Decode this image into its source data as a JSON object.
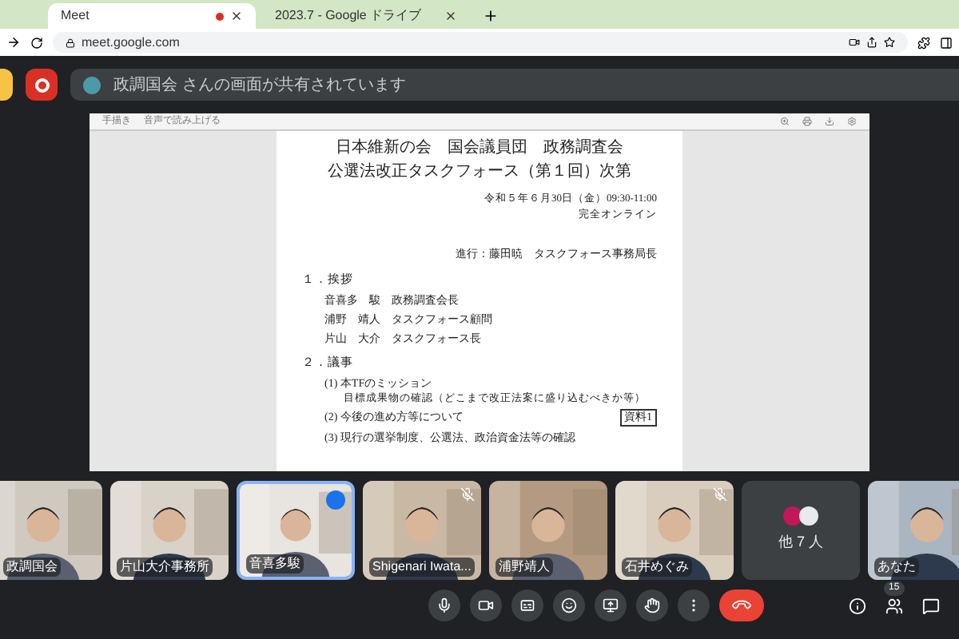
{
  "browser": {
    "tabs": [
      {
        "title": "Meet",
        "recording": true,
        "selected": true
      },
      {
        "title": "2023.7 - Google ドライブ",
        "recording": false,
        "selected": false
      }
    ],
    "url": "meet.google.com"
  },
  "banner": {
    "text": "政調国会 さんの画面が共有されています"
  },
  "viewer_toolbar": {
    "pen_label": "手描き",
    "read_aloud": "音声で読み上げる"
  },
  "document": {
    "title_lines": [
      "日本維新の会　国会議員団　政務調査会",
      "公選法改正タスクフォース（第１回）次第"
    ],
    "meta_lines": [
      "令和５年６月30日（金）09:30-11:00",
      "完全オンライン"
    ],
    "moderator": "進行：藤田暁　タスクフォース事務局長",
    "sections": [
      {
        "heading": "１．挨拶",
        "items": [
          {
            "text": "音喜多　駿　政務調査会長"
          },
          {
            "text": "浦野　靖人　タスクフォース顧問"
          },
          {
            "text": "片山　大介　タスクフォース長"
          }
        ]
      },
      {
        "heading": "２．議事",
        "items": [
          {
            "text": "(1) 本TFのミッション",
            "sub": "目標成果物の確認（どこまで改正法案に盛り込むべきか等）"
          },
          {
            "text": "(2) 今後の進め方等について",
            "tag": "資料1"
          },
          {
            "text": "(3) 現行の選挙制度、公選法、政治資金法等の確認"
          }
        ]
      }
    ]
  },
  "participants": [
    {
      "kind": "video",
      "name": "政調国会",
      "selected": false,
      "muted": false
    },
    {
      "kind": "video",
      "name": "片山大介事務所",
      "selected": false,
      "muted": false
    },
    {
      "kind": "video",
      "name": "音喜多駿",
      "selected": true,
      "muted": false
    },
    {
      "kind": "video",
      "name": "Shigenari Iwata...",
      "selected": false,
      "muted": true
    },
    {
      "kind": "video",
      "name": "浦野靖人",
      "selected": false,
      "muted": false
    },
    {
      "kind": "video",
      "name": "石井めぐみ",
      "selected": false,
      "muted": true
    },
    {
      "kind": "others",
      "name": "他 7 人",
      "selected": false,
      "muted": false
    },
    {
      "kind": "video",
      "name": "あなた",
      "selected": false,
      "muted": false
    }
  ],
  "participant_count": "15"
}
